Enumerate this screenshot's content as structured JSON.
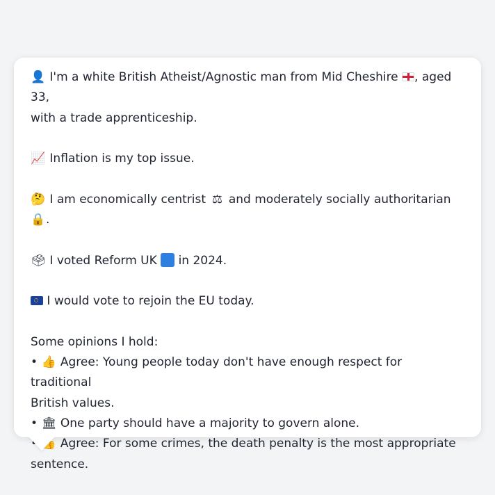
{
  "profile": {
    "intro": {
      "icon": "bust-silhouette-icon",
      "text_before_flag": "I'm a white British Atheist/Agnostic man from Mid Cheshire",
      "flag": "england-flag-icon",
      "text_after_flag": ", aged 33,",
      "text_line2": "with a trade apprenticeship."
    },
    "top_issue": {
      "icon": "chart-increasing-icon",
      "text": "Inflation is my top issue."
    },
    "ideology": {
      "icon": "thinking-face-icon",
      "text_part1": "I am economically centrist",
      "scales_icon": "balance-scale-icon",
      "text_part2": "and moderately socially authoritarian",
      "lock_icon": "padlock-icon",
      "text_end": "."
    },
    "vote": {
      "icon": "ballot-box-icon",
      "text_part1": "I voted Reform UK",
      "party_icon": "blue-square-icon",
      "text_part2": "in 2024."
    },
    "eu": {
      "icon": "eu-flag-icon",
      "text": "I would vote to rejoin the EU today."
    },
    "opinions": {
      "heading": "Some opinions I hold:",
      "bullet": "•",
      "items": [
        {
          "icon": "thumbs-up-icon",
          "line1": "Agree: Young people today don't have enough respect for traditional",
          "line2": "British values."
        },
        {
          "icon": "classical-building-icon",
          "line1": "One party should have a majority to govern alone.",
          "line2": ""
        },
        {
          "icon": "thumbs-up-icon",
          "line1": "Agree: For some crimes, the death penalty is the most appropriate",
          "line2": "sentence."
        }
      ]
    }
  }
}
